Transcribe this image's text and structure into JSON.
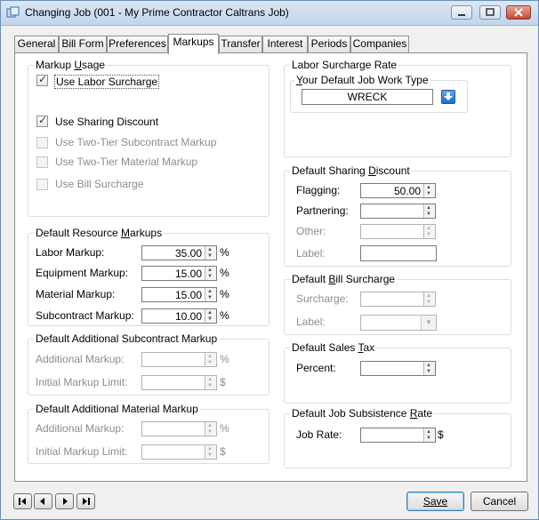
{
  "window": {
    "title": "Changing Job  (001  - My Prime Contractor Caltrans Job)"
  },
  "tabs": [
    {
      "label": "General"
    },
    {
      "label": "Bill Form"
    },
    {
      "label": "Preferences"
    },
    {
      "label": "Markups"
    },
    {
      "label": "Transfer"
    },
    {
      "label": "Interest"
    },
    {
      "label": "Periods"
    },
    {
      "label": "Companies"
    }
  ],
  "active_tab": "Markups",
  "markup_usage": {
    "title": "Markup Usage",
    "items": [
      {
        "label": "Use Labor Surcharge",
        "checked": true,
        "enabled": true
      },
      {
        "label": "Use Sharing Discount",
        "checked": true,
        "enabled": true
      },
      {
        "label": "Use Two-Tier Subcontract Markup",
        "checked": false,
        "enabled": false
      },
      {
        "label": "Use Two-Tier Material Markup",
        "checked": false,
        "enabled": false
      },
      {
        "label": "Use Bill Surcharge",
        "checked": false,
        "enabled": false
      }
    ]
  },
  "resource_markups": {
    "title": "Default Resource Markups",
    "rows": [
      {
        "label": "Labor Markup:",
        "value": "35.00",
        "unit": "%"
      },
      {
        "label": "Equipment Markup:",
        "value": "15.00",
        "unit": "%"
      },
      {
        "label": "Material Markup:",
        "value": "15.00",
        "unit": "%"
      },
      {
        "label": "Subcontract Markup:",
        "value": "10.00",
        "unit": "%"
      }
    ]
  },
  "addl_subcontract": {
    "title": "Default Additional Subcontract Markup",
    "rows": [
      {
        "label": "Additional Markup:",
        "value": "",
        "unit": "%"
      },
      {
        "label": "Initial Markup Limit:",
        "value": "",
        "unit": "$"
      }
    ]
  },
  "addl_material": {
    "title": "Default Additional Material Markup",
    "rows": [
      {
        "label": "Additional Markup:",
        "value": "",
        "unit": "%"
      },
      {
        "label": "Initial Markup Limit:",
        "value": "",
        "unit": "$"
      }
    ]
  },
  "labor_surcharge": {
    "title": "Labor Surcharge Rate",
    "subtitle": "Your Default Job Work Type",
    "work_type": "WRECK"
  },
  "sharing_discount": {
    "title": "Default Sharing Discount",
    "rows": [
      {
        "label": "Flagging:",
        "value": "50.00"
      },
      {
        "label": "Partnering:",
        "value": ""
      },
      {
        "label": "Other:",
        "value": ""
      },
      {
        "label": "Label:",
        "value": ""
      }
    ]
  },
  "bill_surcharge": {
    "title": "Default Bill Surcharge",
    "rows": [
      {
        "label": "Surcharge:",
        "value": ""
      },
      {
        "label": "Label:",
        "value": ""
      }
    ]
  },
  "sales_tax": {
    "title": "Default Sales Tax",
    "percent_label": "Percent:",
    "percent_value": ""
  },
  "subsistence": {
    "title": "Default Job Subsistence Rate",
    "job_rate_label": "Job Rate:",
    "job_rate_value": "",
    "unit": "$"
  },
  "footer": {
    "save_label": "Save",
    "cancel_label": "Cancel"
  },
  "colors": {
    "accent_blue": "#2f7fd6"
  }
}
